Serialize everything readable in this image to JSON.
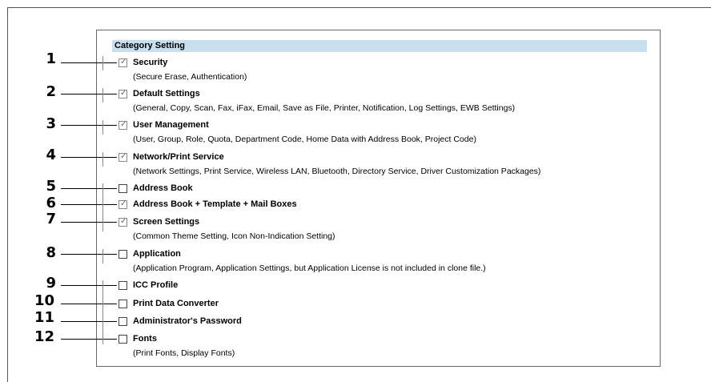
{
  "header": {
    "title": "Category Setting"
  },
  "items": [
    {
      "number": "1",
      "label": "Security",
      "description": "(Secure Erase, Authentication)",
      "checked": true
    },
    {
      "number": "2",
      "label": "Default Settings",
      "description": "(General, Copy, Scan, Fax, iFax, Email, Save as File, Printer, Notification, Log Settings, EWB Settings)",
      "checked": true
    },
    {
      "number": "3",
      "label": "User Management",
      "description": "(User, Group, Role, Quota, Department Code, Home Data with Address Book, Project Code)",
      "checked": true
    },
    {
      "number": "4",
      "label": "Network/Print Service",
      "description": "(Network Settings, Print Service, Wireless LAN, Bluetooth, Directory Service, Driver Customization Packages)",
      "checked": true
    },
    {
      "number": "5",
      "label": "Address Book",
      "description": "",
      "checked": false
    },
    {
      "number": "6",
      "label": "Address Book + Template + Mail Boxes",
      "description": "",
      "checked": true
    },
    {
      "number": "7",
      "label": "Screen Settings",
      "description": "(Common Theme Setting, Icon Non-Indication Setting)",
      "checked": true
    },
    {
      "number": "8",
      "label": "Application",
      "description": "(Application Program, Application Settings, but Application License is not included in clone file.)",
      "checked": false
    },
    {
      "number": "9",
      "label": "ICC Profile",
      "description": "",
      "checked": false
    },
    {
      "number": "10",
      "label": "Print Data Converter",
      "description": "",
      "checked": false
    },
    {
      "number": "11",
      "label": "Administrator's Password",
      "description": "",
      "checked": false
    },
    {
      "number": "12",
      "label": "Fonts",
      "description": "(Print Fonts, Display Fonts)",
      "checked": false
    }
  ]
}
